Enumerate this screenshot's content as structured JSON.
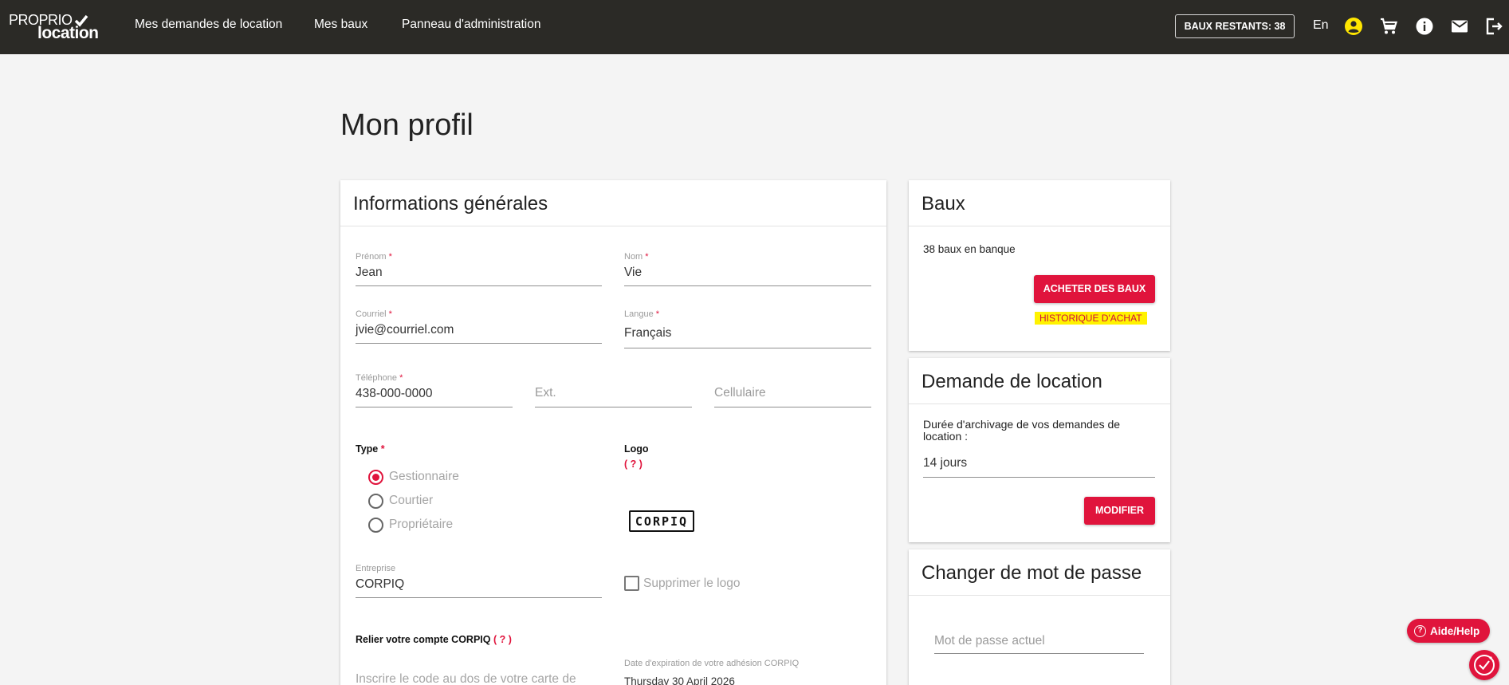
{
  "brand": {
    "line1": "PROPRIO",
    "line2": "location"
  },
  "nav": {
    "links": [
      "Mes demandes de location",
      "Mes baux",
      "Panneau d'administration"
    ],
    "baux_badge": "BAUX RESTANTS: 38",
    "language": "En",
    "icons": [
      "account-circle-icon",
      "cart-icon",
      "info-icon",
      "mail-icon",
      "logout-icon"
    ]
  },
  "page_title": "Mon profil",
  "general": {
    "title": "Informations générales",
    "prenom": {
      "label": "Prénom",
      "value": "Jean"
    },
    "nom": {
      "label": "Nom",
      "value": "Vie"
    },
    "courriel": {
      "label": "Courriel",
      "value": "jvie@courriel.com"
    },
    "langue": {
      "label": "Langue",
      "value": "Français"
    },
    "telephone": {
      "label": "Téléphone",
      "value": "438-000-0000"
    },
    "ext": {
      "placeholder": "Ext."
    },
    "cellulaire": {
      "placeholder": "Cellulaire"
    },
    "required_mark": "*",
    "type": {
      "label": "Type",
      "options": [
        "Gestionnaire",
        "Courtier",
        "Propriétaire"
      ],
      "selected": "Gestionnaire"
    },
    "logo": {
      "label": "Logo",
      "help": "( ? )",
      "image_text": "CORPIQ"
    },
    "entreprise": {
      "label": "Entreprise",
      "value": "CORPIQ"
    },
    "supprimer_logo": "Supprimer le logo",
    "relier": {
      "label": "Relier votre compte CORPIQ",
      "help": "( ? )"
    },
    "code_placeholder": "Inscrire le code au dos de votre carte de",
    "expiration": {
      "label": "Date d'expiration de votre adhésion CORPIQ",
      "value": "Thursday 30 April 2026"
    }
  },
  "baux": {
    "title": "Baux",
    "count_text": "38 baux en banque",
    "buy_button": "ACHETER DES BAUX",
    "history_link": "HISTORIQUE D'ACHAT"
  },
  "demande": {
    "title": "Demande de location",
    "archive_label": "Durée d'archivage de vos demandes de location :",
    "archive_value": "14 jours",
    "modify_button": "MODIFIER"
  },
  "password": {
    "title": "Changer de mot de passe",
    "current_placeholder": "Mot de passe actuel"
  },
  "help_button": "Aide/Help",
  "colors": {
    "accent": "#e0143c",
    "topbar": "#2b2a26",
    "highlight": "#fff200"
  }
}
